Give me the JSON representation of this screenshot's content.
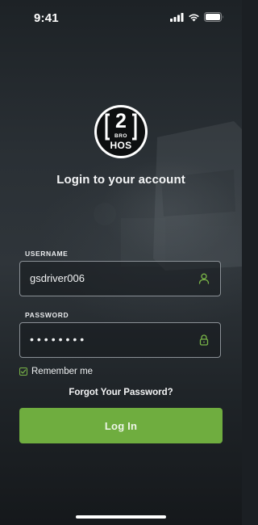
{
  "status_bar": {
    "time": "9:41"
  },
  "logo": {
    "number": "2",
    "bro": "BRO",
    "hos": "HOS"
  },
  "title": "Login to your account",
  "username": {
    "label": "USERNAME",
    "value": "gsdriver006"
  },
  "password": {
    "label": "PASSWORD",
    "masked_value": "••••••••"
  },
  "remember": {
    "label": "Remember me",
    "checked": true
  },
  "forgot_label": "Forgot Your Password?",
  "login_label": "Log In",
  "colors": {
    "accent": "#6fad3f",
    "icon_green": "#7ab648",
    "border": "#8a9096"
  }
}
